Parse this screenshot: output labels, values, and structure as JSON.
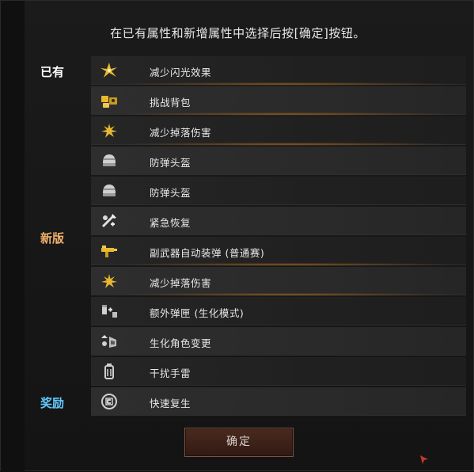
{
  "instruction": "在已有属性和新增属性中选择后按[确定]按钮。",
  "groups": {
    "existing": "已有",
    "new": "新版",
    "reward": "奖励"
  },
  "rows": [
    {
      "label": "减少闪光效果",
      "icon": "flash-reduce-icon"
    },
    {
      "label": "挑战背包",
      "icon": "challenge-backpack-icon"
    },
    {
      "label": "减少掉落伤害",
      "icon": "fall-damage-icon"
    },
    {
      "label": "防弹头盔",
      "icon": "helmet-icon"
    },
    {
      "label": "防弹头盔",
      "icon": "helmet-icon"
    },
    {
      "label": "紧急恢复",
      "icon": "emergency-recover-icon"
    },
    {
      "label": "副武器自动装弹 (普通赛)",
      "icon": "auto-reload-icon"
    },
    {
      "label": "减少掉落伤害",
      "icon": "fall-damage-icon"
    },
    {
      "label": "额外弹匣 (生化模式)",
      "icon": "extra-magazine-icon"
    },
    {
      "label": "生化角色变更",
      "icon": "role-change-icon"
    },
    {
      "label": "干扰手雷",
      "icon": "jammer-grenade-icon"
    },
    {
      "label": "快速复生",
      "icon": "quick-respawn-icon"
    }
  ],
  "confirm_label": "确定",
  "colors": {
    "new_label": "#f0b06a",
    "reward_label": "#62c9ff",
    "icon_gold": "#e8b830"
  }
}
